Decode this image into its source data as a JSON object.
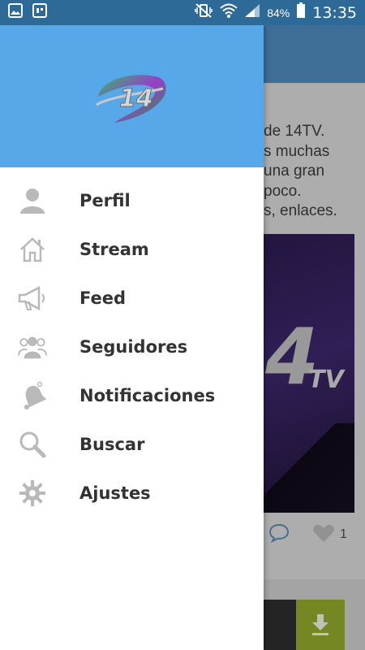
{
  "status_bar": {
    "battery_percent": "84%",
    "time": "13:35"
  },
  "drawer": {
    "header_color": "#57a8e9",
    "logo_text": "14",
    "items": [
      {
        "label": "Perfil",
        "icon": "person-icon"
      },
      {
        "label": "Stream",
        "icon": "home-icon"
      },
      {
        "label": "Feed",
        "icon": "megaphone-icon"
      },
      {
        "label": "Seguidores",
        "icon": "group-icon"
      },
      {
        "label": "Notificaciones",
        "icon": "bell-icon"
      },
      {
        "label": "Buscar",
        "icon": "search-icon"
      },
      {
        "label": "Ajustes",
        "icon": "gear-icon"
      }
    ]
  },
  "background": {
    "text_lines": [
      "de 14TV.",
      "s muchas",
      "una gran",
      "poco.",
      "s, enlaces."
    ],
    "image_logo": "4",
    "image_logo_sub": "TV",
    "like_count": "1",
    "download_color": "#8fa52a"
  }
}
